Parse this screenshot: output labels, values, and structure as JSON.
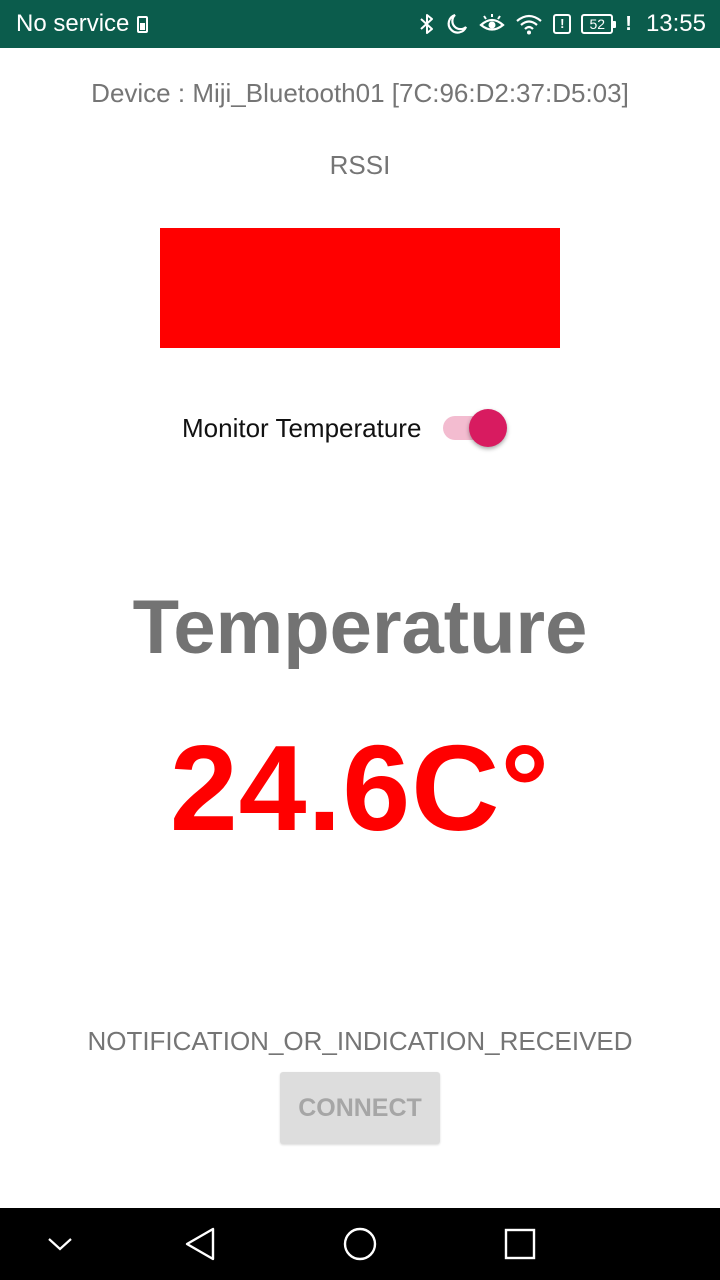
{
  "status_bar": {
    "carrier": "No service",
    "battery_level": "52",
    "time": "13:55",
    "background_color": "#0b5c4c",
    "icons": [
      "sim-icon",
      "bluetooth-icon",
      "moon-icon",
      "eye-icon",
      "wifi-icon",
      "alert-icon",
      "battery-icon",
      "charging-alert-icon"
    ]
  },
  "device": {
    "text": "Device : Miji_Bluetooth01 [7C:96:D2:37:D5:03]"
  },
  "rssi": {
    "label": "RSSI",
    "indicator_color": "#ff0000"
  },
  "monitor": {
    "label": "Monitor Temperature",
    "toggle_on": true,
    "accent_color": "#d81b60"
  },
  "temperature": {
    "title": "Temperature",
    "value": "24.6C°",
    "value_color": "#ff0000"
  },
  "notification": {
    "text": "NOTIFICATION_OR_INDICATION_RECEIVED"
  },
  "connect_button": {
    "label": "CONNECT",
    "enabled": false
  },
  "nav_bar": {
    "icons": [
      "chevron-down-icon",
      "back-icon",
      "home-icon",
      "recents-icon"
    ]
  }
}
